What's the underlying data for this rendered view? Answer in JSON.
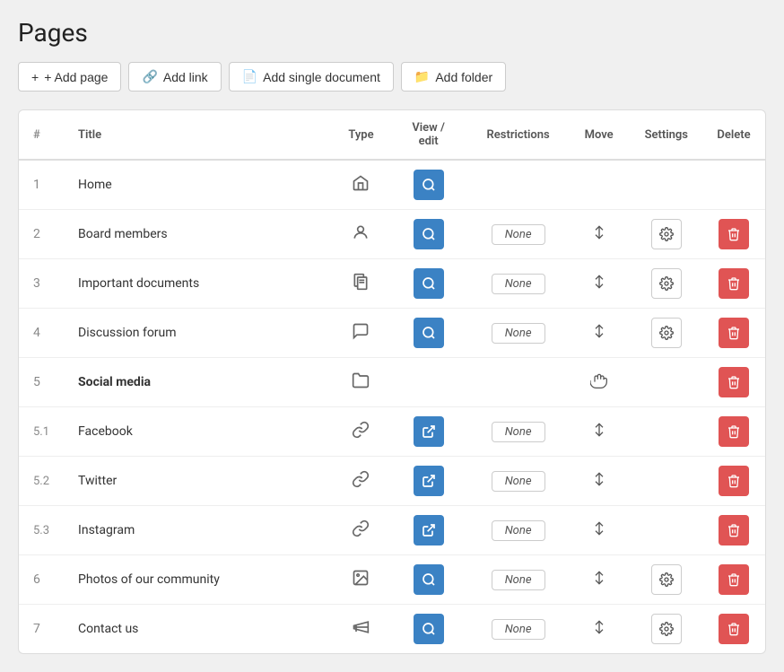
{
  "page": {
    "title": "Pages"
  },
  "toolbar": {
    "add_page": "+ Add page",
    "add_link": "Add link",
    "add_single_document": "Add single document",
    "add_folder": "Add folder"
  },
  "table": {
    "headers": {
      "num": "#",
      "title": "Title",
      "type": "Type",
      "view_edit": "View / edit",
      "restrictions": "Restrictions",
      "move": "Move",
      "settings": "Settings",
      "delete": "Delete"
    },
    "rows": [
      {
        "num": "1",
        "title": "Home",
        "type": "home",
        "has_view": true,
        "view_type": "search",
        "has_restrictions": false,
        "has_move": false,
        "has_settings": false,
        "has_delete": false,
        "bold": false,
        "sub": false
      },
      {
        "num": "2",
        "title": "Board members",
        "type": "user",
        "has_view": true,
        "view_type": "search",
        "has_restrictions": true,
        "restriction_value": "None",
        "has_move": true,
        "has_settings": true,
        "has_delete": true,
        "bold": false,
        "sub": false
      },
      {
        "num": "3",
        "title": "Important documents",
        "type": "document",
        "has_view": true,
        "view_type": "search",
        "has_restrictions": true,
        "restriction_value": "None",
        "has_move": true,
        "has_settings": true,
        "has_delete": true,
        "bold": false,
        "sub": false
      },
      {
        "num": "4",
        "title": "Discussion forum",
        "type": "forum",
        "has_view": true,
        "view_type": "search",
        "has_restrictions": true,
        "restriction_value": "None",
        "has_move": true,
        "has_settings": true,
        "has_delete": true,
        "bold": false,
        "sub": false
      },
      {
        "num": "5",
        "title": "Social media",
        "type": "folder",
        "has_view": false,
        "view_type": null,
        "has_restrictions": false,
        "has_move": true,
        "move_type": "hand",
        "has_settings": false,
        "has_delete": true,
        "bold": true,
        "sub": false
      },
      {
        "num": "5.1",
        "title": "Facebook",
        "type": "link",
        "has_view": true,
        "view_type": "external",
        "has_restrictions": true,
        "restriction_value": "None",
        "has_move": true,
        "has_settings": false,
        "has_delete": true,
        "bold": false,
        "sub": true
      },
      {
        "num": "5.2",
        "title": "Twitter",
        "type": "link",
        "has_view": true,
        "view_type": "external",
        "has_restrictions": true,
        "restriction_value": "None",
        "has_move": true,
        "has_settings": false,
        "has_delete": true,
        "bold": false,
        "sub": true
      },
      {
        "num": "5.3",
        "title": "Instagram",
        "type": "link",
        "has_view": true,
        "view_type": "external",
        "has_restrictions": true,
        "restriction_value": "None",
        "has_move": true,
        "has_settings": false,
        "has_delete": true,
        "bold": false,
        "sub": true
      },
      {
        "num": "6",
        "title": "Photos of our community",
        "type": "photo",
        "has_view": true,
        "view_type": "search",
        "has_restrictions": true,
        "restriction_value": "None",
        "has_move": true,
        "has_settings": true,
        "has_delete": true,
        "bold": false,
        "sub": false
      },
      {
        "num": "7",
        "title": "Contact us",
        "type": "megaphone",
        "has_view": true,
        "view_type": "search",
        "has_restrictions": true,
        "restriction_value": "None",
        "has_move": true,
        "has_settings": true,
        "has_delete": true,
        "bold": false,
        "sub": false
      }
    ]
  }
}
